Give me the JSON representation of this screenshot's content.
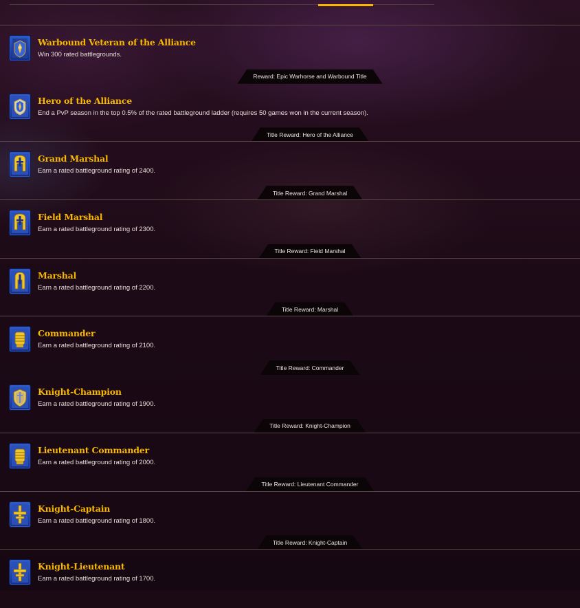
{
  "colors": {
    "accent": "#f8b700",
    "background": "#1b0a14",
    "divider": "#5b4a48",
    "reward_bg": "#0b0507",
    "text": "#e6dcd8",
    "icon_blue": "#2b58c9"
  },
  "achievements": [
    {
      "title": "Warbound Veteran of the Alliance",
      "description": "Win 300 rated battlegrounds.",
      "reward": "Reward: Epic Warhorse and Warbound Title",
      "icon": "alliance-banner-icon"
    },
    {
      "title": "Hero of the Alliance",
      "description": "End a PvP season in the top 0.5% of the rated battleground ladder (requires 50 games won in the current season).",
      "reward": "Title Reward: Hero of the Alliance",
      "icon": "alliance-crest-icon"
    },
    {
      "title": "Grand Marshal",
      "description": "Earn a rated battleground rating of 2400.",
      "reward": "Title Reward: Grand Marshal",
      "icon": "helmet-icon"
    },
    {
      "title": "Field Marshal",
      "description": "Earn a rated battleground rating of 2300.",
      "reward": "Title Reward: Field Marshal",
      "icon": "helmet-icon"
    },
    {
      "title": "Marshal",
      "description": "Earn a rated battleground rating of 2200.",
      "reward": "Title Reward: Marshal",
      "icon": "helmet-icon"
    },
    {
      "title": "Commander",
      "description": "Earn a rated battleground rating of 2100.",
      "reward": "Title Reward: Commander",
      "icon": "gauntlet-icon"
    },
    {
      "title": "Knight-Champion",
      "description": "Earn a rated battleground rating of 1900.",
      "reward": "Title Reward: Knight-Champion",
      "icon": "shield-icon"
    },
    {
      "title": "Lieutenant Commander",
      "description": "Earn a rated battleground rating of 2000.",
      "reward": "Title Reward: Lieutenant Commander",
      "icon": "gauntlet-icon"
    },
    {
      "title": "Knight-Captain",
      "description": "Earn a rated battleground rating of 1800.",
      "reward": "Title Reward: Knight-Captain",
      "icon": "sword-cross-icon"
    },
    {
      "title": "Knight-Lieutenant",
      "description": "Earn a rated battleground rating of 1700.",
      "reward": "",
      "icon": "sword-cross-icon"
    }
  ]
}
